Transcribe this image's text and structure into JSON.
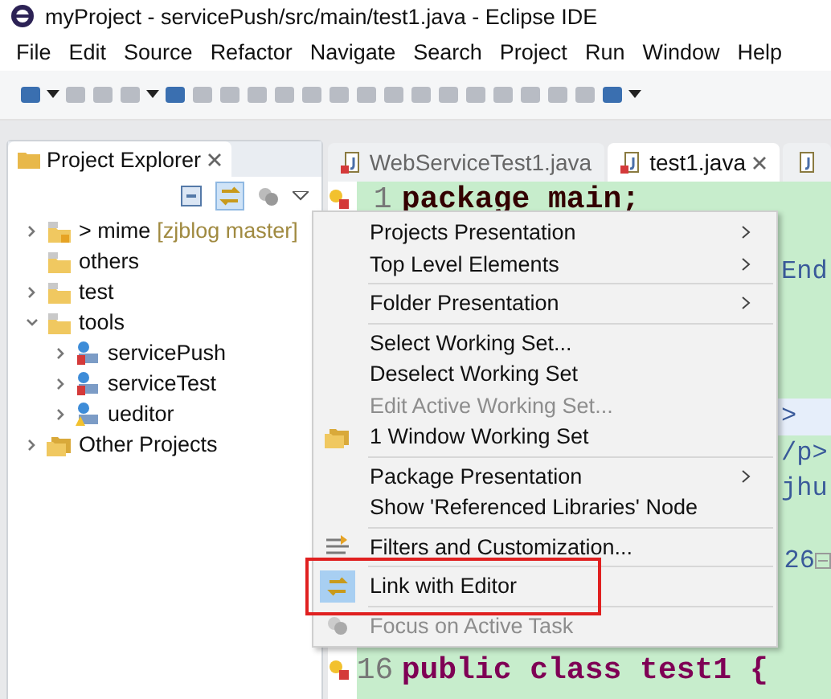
{
  "window": {
    "title": "myProject - servicePush/src/main/test1.java - Eclipse IDE"
  },
  "menu_bar": [
    "File",
    "Edit",
    "Source",
    "Refactor",
    "Navigate",
    "Search",
    "Project",
    "Run",
    "Window",
    "Help"
  ],
  "explorer": {
    "title": "Project Explorer",
    "link_toggle_on": true,
    "tree": [
      {
        "label": "> mime",
        "branch": "[zjblog master]",
        "kind": "project",
        "expanded": false,
        "has_children": true
      },
      {
        "label": "others",
        "kind": "folder",
        "expanded": false,
        "has_children": false
      },
      {
        "label": "test",
        "kind": "folder",
        "expanded": false,
        "has_children": true
      },
      {
        "label": "tools",
        "kind": "folder",
        "expanded": true,
        "has_children": true,
        "children": [
          {
            "label": "servicePush",
            "kind": "webproject",
            "expanded": false,
            "has_children": true
          },
          {
            "label": "serviceTest",
            "kind": "webproject",
            "expanded": false,
            "has_children": true
          },
          {
            "label": "ueditor",
            "kind": "warnproject",
            "expanded": false,
            "has_children": true
          }
        ]
      },
      {
        "label": "Other Projects",
        "kind": "workingset",
        "expanded": false,
        "has_children": true
      }
    ]
  },
  "editor": {
    "tabs": [
      {
        "label": "WebServiceTest1.java",
        "selected": false
      },
      {
        "label": "test1.java",
        "selected": true
      },
      {
        "selected": false
      }
    ],
    "rows": [
      {
        "number": "1",
        "code": "package main;",
        "kind": "package"
      },
      {},
      {
        "fragment": "End"
      },
      {},
      {},
      {},
      {
        "fragment": ">",
        "highlighted": true
      },
      {
        "fragment": "/p>"
      },
      {
        "fragment": "jhu"
      },
      {},
      {
        "fragment": "26",
        "fold": true
      },
      {},
      {},
      {
        "number": "16",
        "code": "public class test1 {",
        "kind": "class"
      }
    ]
  },
  "context_menu": {
    "items": [
      {
        "kind": "item",
        "label": "Projects Presentation",
        "submenu": true
      },
      {
        "kind": "item",
        "label": "Top Level Elements",
        "submenu": true
      },
      {
        "kind": "separator"
      },
      {
        "kind": "item",
        "label": "Folder Presentation",
        "submenu": true
      },
      {
        "kind": "separator"
      },
      {
        "kind": "item",
        "label": "Select Working Set..."
      },
      {
        "kind": "item",
        "label": "Deselect Working Set"
      },
      {
        "kind": "item",
        "label": "Edit Active Working Set...",
        "disabled": true
      },
      {
        "kind": "workingset-item",
        "label": "1 Window Working Set"
      },
      {
        "kind": "separator"
      },
      {
        "kind": "item",
        "label": "Package Presentation",
        "submenu": true
      },
      {
        "kind": "item",
        "label": "Show 'Referenced Libraries' Node"
      },
      {
        "kind": "separator"
      },
      {
        "kind": "filter-item",
        "label": "Filters and Customization..."
      },
      {
        "kind": "separator"
      },
      {
        "kind": "link-item",
        "label": "Link with Editor",
        "checked": true,
        "highlighted": true
      },
      {
        "kind": "separator"
      },
      {
        "kind": "task-item",
        "label": "Focus on Active Task",
        "disabled": true
      }
    ]
  }
}
